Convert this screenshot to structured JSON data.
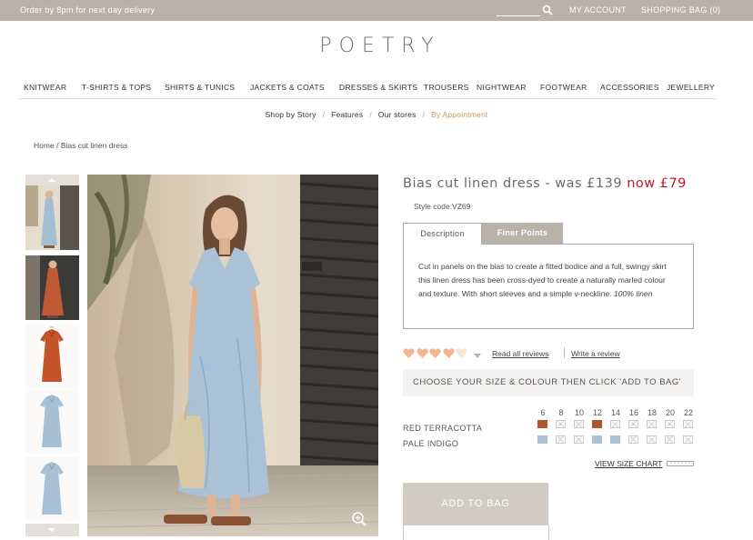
{
  "topbar": {
    "promo": "Order by 8pm for next day delivery",
    "search_value": "",
    "account": "MY ACCOUNT",
    "bag": "SHOPPING BAG (0)"
  },
  "brand": {
    "logo": "POETRY"
  },
  "nav": {
    "items": [
      "KNITWEAR",
      "T-SHIRTS & TOPS",
      "SHIRTS & TUNICS",
      "JACKETS & COATS",
      "DRESSES & SKIRTS",
      "TROUSERS",
      "NIGHTWEAR",
      "FOOTWEAR",
      "ACCESSORIES",
      "JEWELLERY"
    ]
  },
  "subnav": {
    "items": [
      "Shop by Story",
      "Features",
      "Our stores",
      "By Appointment"
    ],
    "separator": "/"
  },
  "breadcrumb": {
    "home": "Home",
    "separator": "/",
    "current": "Bias cut linen dress"
  },
  "product": {
    "name_prefix": "Bias cut linen dress - was £139",
    "now_price": "now £79",
    "style_code": "Style code:VZ69",
    "tabs": [
      "Description",
      "Finer Points"
    ],
    "description": "Cut in panels on the bias to create a fitted bodice and a full, swingy skirt this linen dress has been cross-dyed to create a naturally marled colour and texture. With short sleeves and a simple v-neckline. ",
    "fabric": "100% linen",
    "rating": 4,
    "rating_max": 5,
    "reviews_read": "Read all reviews",
    "reviews_write": "Write a review",
    "choose_prompt": "CHOOSE YOUR SIZE & COLOUR THEN CLICK 'ADD TO BAG'",
    "sizes": [
      "6",
      "8",
      "10",
      "12",
      "14",
      "16",
      "18",
      "20",
      "22"
    ],
    "colours": [
      {
        "name": "RED TERRACOTTA",
        "hex": "#b4532f",
        "available": [
          true,
          false,
          false,
          true,
          false,
          false,
          false,
          false,
          false
        ]
      },
      {
        "name": "PALE INDIGO",
        "hex": "#a9c2d6",
        "available": [
          true,
          false,
          false,
          true,
          true,
          false,
          false,
          false,
          false
        ]
      }
    ],
    "size_chart": "VIEW SIZE CHART",
    "add_to_bag": "ADD TO BAG"
  },
  "colors": {
    "topbar": "#b9b2aa",
    "price_red": "#c0182b",
    "accent_link": "#c8955c",
    "heart_full": "#f3b48f",
    "heart_empty": "#fbe3d4"
  },
  "icons": [
    "search-icon",
    "chevron-up-icon",
    "chevron-down-icon",
    "zoom-in-icon",
    "heart-icon",
    "ruler-icon"
  ]
}
